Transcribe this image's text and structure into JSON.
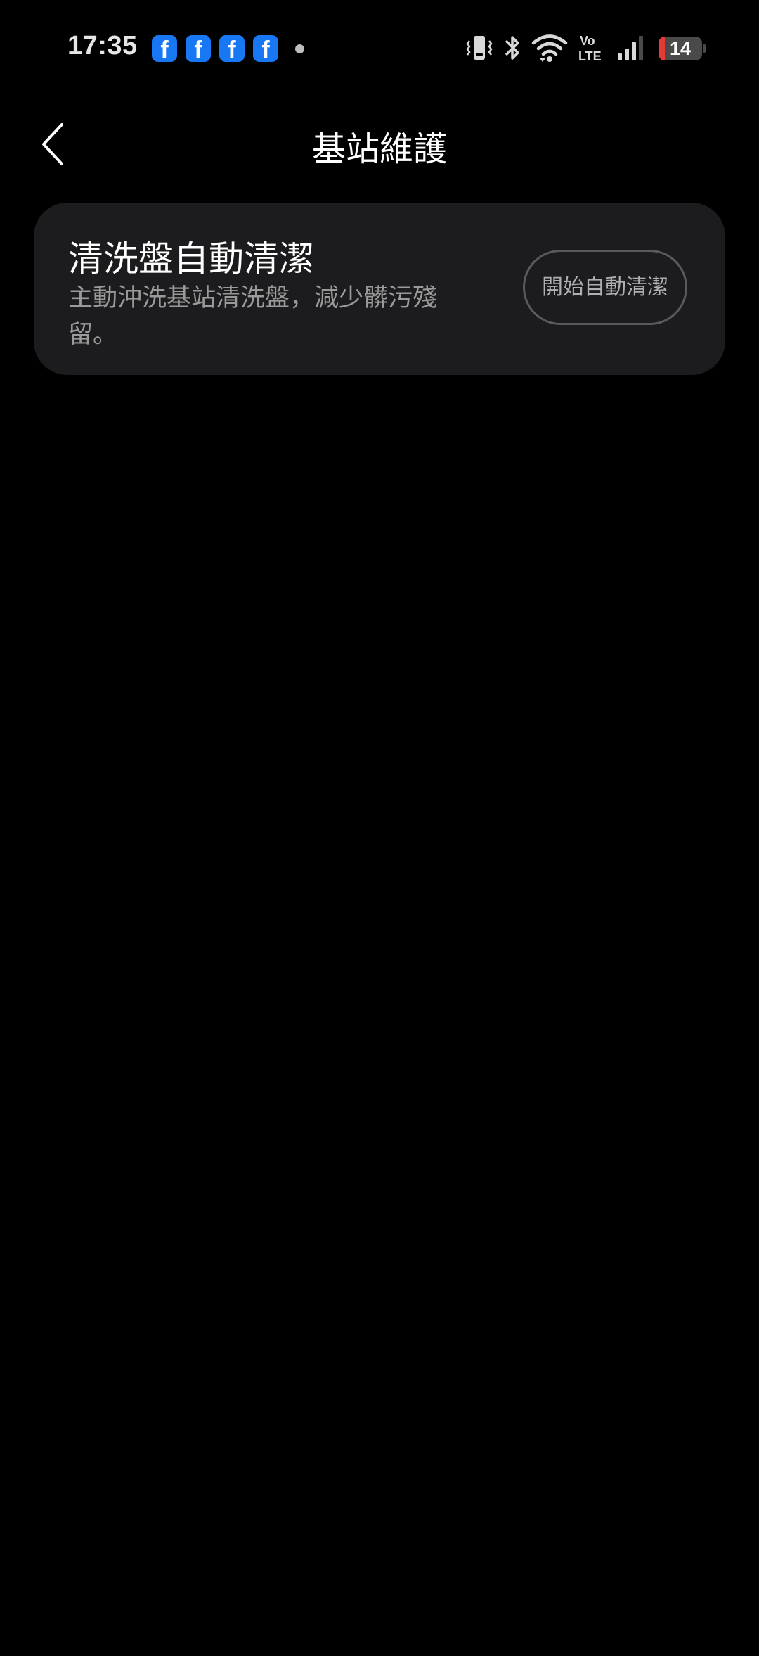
{
  "status_bar": {
    "time": "17:35",
    "notification_icons": [
      "facebook-icon",
      "facebook-icon",
      "facebook-icon",
      "facebook-icon"
    ],
    "fb_glyph": "f",
    "battery_level": 14,
    "battery_text": "14",
    "vo_label": "Vo",
    "lte_label": "LTE"
  },
  "header": {
    "title": "基站維護"
  },
  "card": {
    "title": "清洗盤自動清潔",
    "description": "主動沖洗基站清洗盤，減少髒污殘留。",
    "button_label": "開始自動清潔"
  },
  "colors": {
    "background": "#000000",
    "card_background": "#1c1c1e",
    "secondary_text": "#9a9a9a",
    "battery_low": "#e53935",
    "facebook_blue": "#1877f2"
  }
}
